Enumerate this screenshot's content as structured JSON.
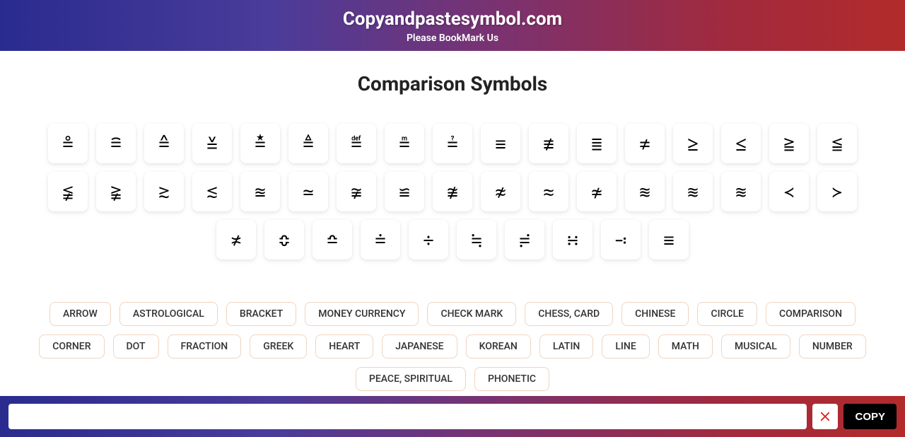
{
  "header": {
    "title": "Copyandpastesymbol.com",
    "subtitle": "Please BookMark Us"
  },
  "page_title": "Comparison Symbols",
  "symbols": [
    "≗",
    "≘",
    "≙",
    "≚",
    "≛",
    "≜",
    "≝",
    "≞",
    "≟",
    "≡",
    "≢",
    "≣",
    "≠",
    "≥",
    "≤",
    "≧",
    "≦",
    "≨",
    "≩",
    "≳",
    "≲",
    "≊",
    "≃",
    "≆",
    "≌",
    "≇",
    "≉",
    "≈",
    "≄",
    "≋",
    "≋",
    "≋",
    "≺",
    "≻",
    "≭",
    "≎",
    "≏",
    "≐",
    "÷",
    "≒",
    "≓",
    "∺",
    "∹",
    "≡"
  ],
  "categories": [
    "ARROW",
    "ASTROLOGICAL",
    "BRACKET",
    "MONEY CURRENCY",
    "CHECK MARK",
    "CHESS, CARD",
    "CHINESE",
    "CIRCLE",
    "COMPARISON",
    "CORNER",
    "DOT",
    "FRACTION",
    "GREEK",
    "HEART",
    "JAPANESE",
    "KOREAN",
    "LATIN",
    "LINE",
    "MATH",
    "MUSICAL",
    "NUMBER",
    "PEACE, SPIRITUAL",
    "PHONETIC"
  ],
  "bottom": {
    "copy_label": "COPY",
    "input_value": ""
  }
}
